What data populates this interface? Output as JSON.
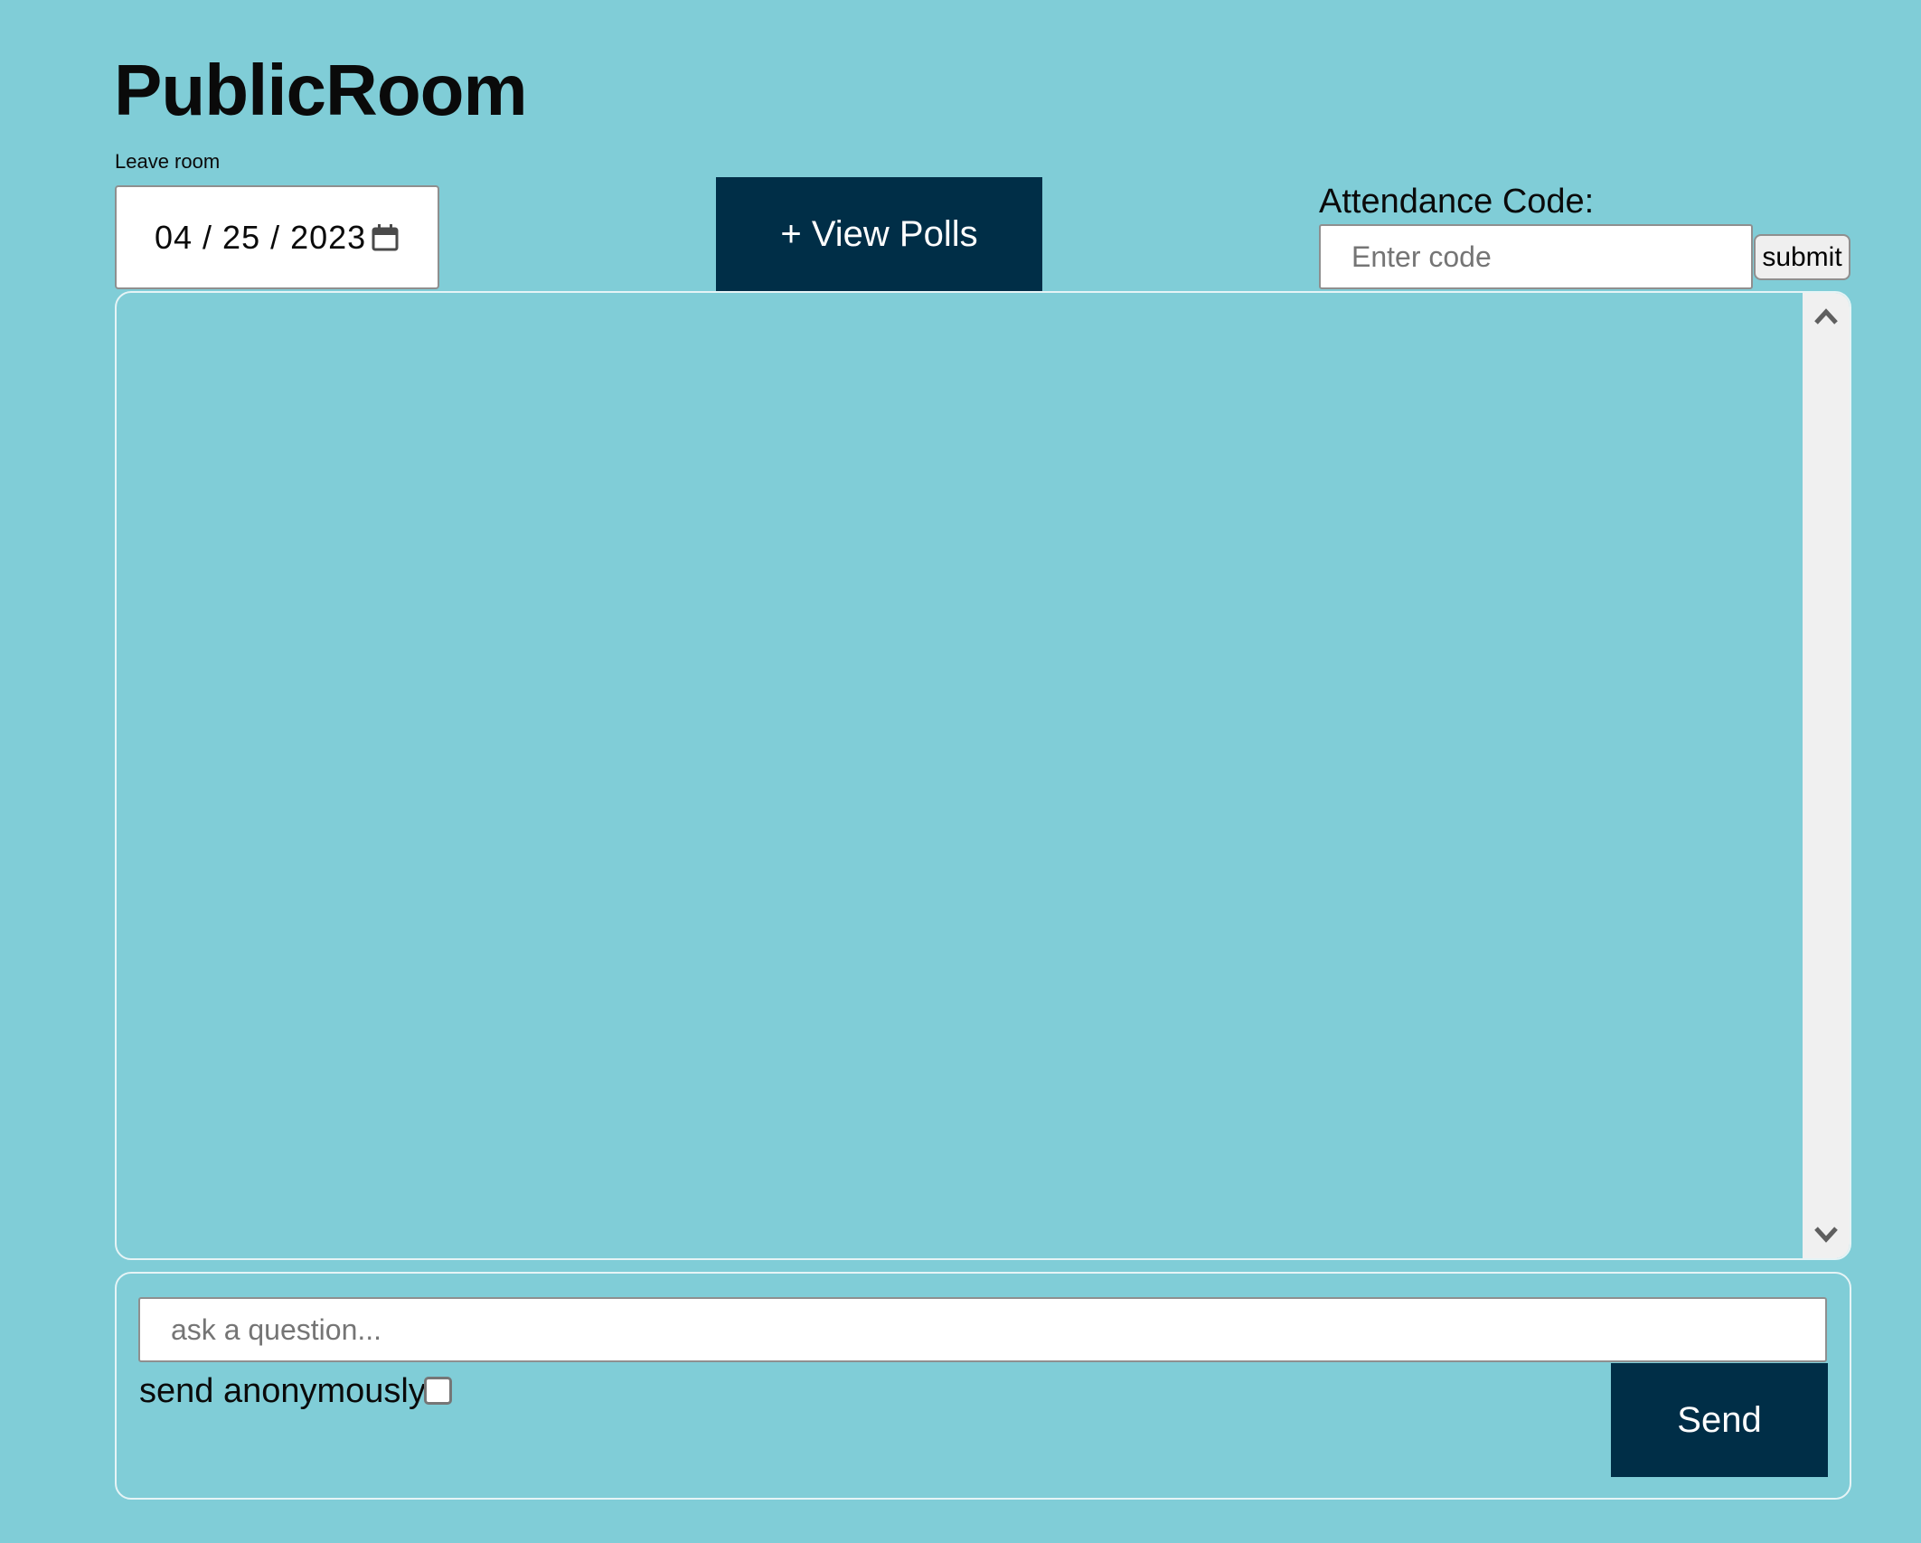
{
  "header": {
    "title": "PublicRoom",
    "leave_room": "Leave room"
  },
  "date_picker": {
    "value": "04 / 25 / 2023",
    "icon": "calendar-icon"
  },
  "view_polls": {
    "label": "+ View Polls"
  },
  "attendance": {
    "label": "Attendance Code:",
    "placeholder": "Enter code",
    "submit_label": "submit"
  },
  "chat": {
    "scroll_up_icon": "chevron-up-icon",
    "scroll_down_icon": "chevron-down-icon"
  },
  "compose": {
    "placeholder": "ask a question...",
    "anonymous_label": "send anonymously",
    "anonymous_checked": false,
    "send_label": "Send"
  },
  "colors": {
    "background": "#80cdd7",
    "primary_button": "#002e47",
    "button_text": "#ffffff",
    "scrollbar": "#f0f0f0"
  }
}
